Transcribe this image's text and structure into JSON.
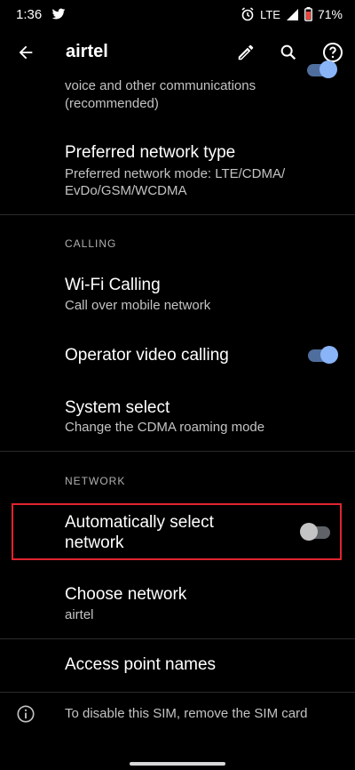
{
  "status_bar": {
    "time": "1:36",
    "network": "LTE",
    "battery": "71%"
  },
  "app_bar": {
    "title": "airtel"
  },
  "items": {
    "previous_summary": "voice and other communications (recommended)",
    "preferred_network": {
      "title": "Preferred network type",
      "summary_line1": "Preferred network mode: LTE/CDMA/",
      "summary_line2": "EvDo/GSM/WCDMA"
    },
    "calling_header": "CALLING",
    "wifi_calling": {
      "title": "Wi-Fi Calling",
      "summary": "Call over mobile network"
    },
    "operator_video": {
      "title": "Operator video calling",
      "enabled": true
    },
    "system_select": {
      "title": "System select",
      "summary": "Change the CDMA roaming mode"
    },
    "network_header": "NETWORK",
    "auto_select": {
      "title_line1": "Automatically select",
      "title_line2": "network",
      "enabled": false
    },
    "choose_network": {
      "title": "Choose network",
      "summary": "airtel"
    },
    "apn": {
      "title": "Access point names"
    }
  },
  "footer": {
    "text": "To disable this SIM, remove the SIM card"
  },
  "colors": {
    "accent": "#8ab4f8",
    "highlight": "#e0242f",
    "background": "#000000"
  }
}
